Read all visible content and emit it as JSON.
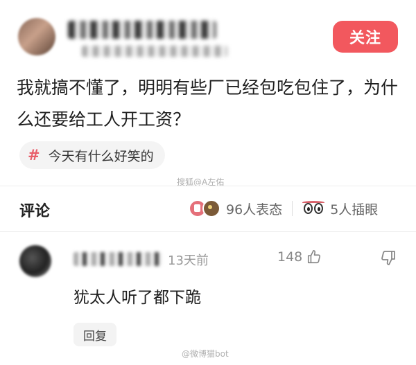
{
  "author": {
    "follow_label": "关注"
  },
  "post": {
    "text": "我就搞不懂了，明明有些厂已经包吃包住了，为什么还要给工人开工资？",
    "topic": "今天有什么好笑的",
    "watermark": "搜狐@A左佑"
  },
  "comments_header": {
    "title": "评论",
    "reactions_text": "96人表态",
    "eyes_text": "5人插眼"
  },
  "comment": {
    "time": "13天前",
    "likes": "148",
    "text": "犹太人听了都下跪",
    "reply_label": "回复"
  },
  "footer": {
    "watermark": "@微博猫bot"
  },
  "colors": {
    "accent": "#f2585e",
    "topic_hash": "#e85f6a",
    "muted_text": "#999999"
  },
  "icons": {
    "topic": "hash-icon",
    "like": "thumbs-up-icon",
    "dislike": "thumbs-down-icon",
    "reaction": "reaction-like-icon",
    "eyes": "eyes-icon"
  }
}
